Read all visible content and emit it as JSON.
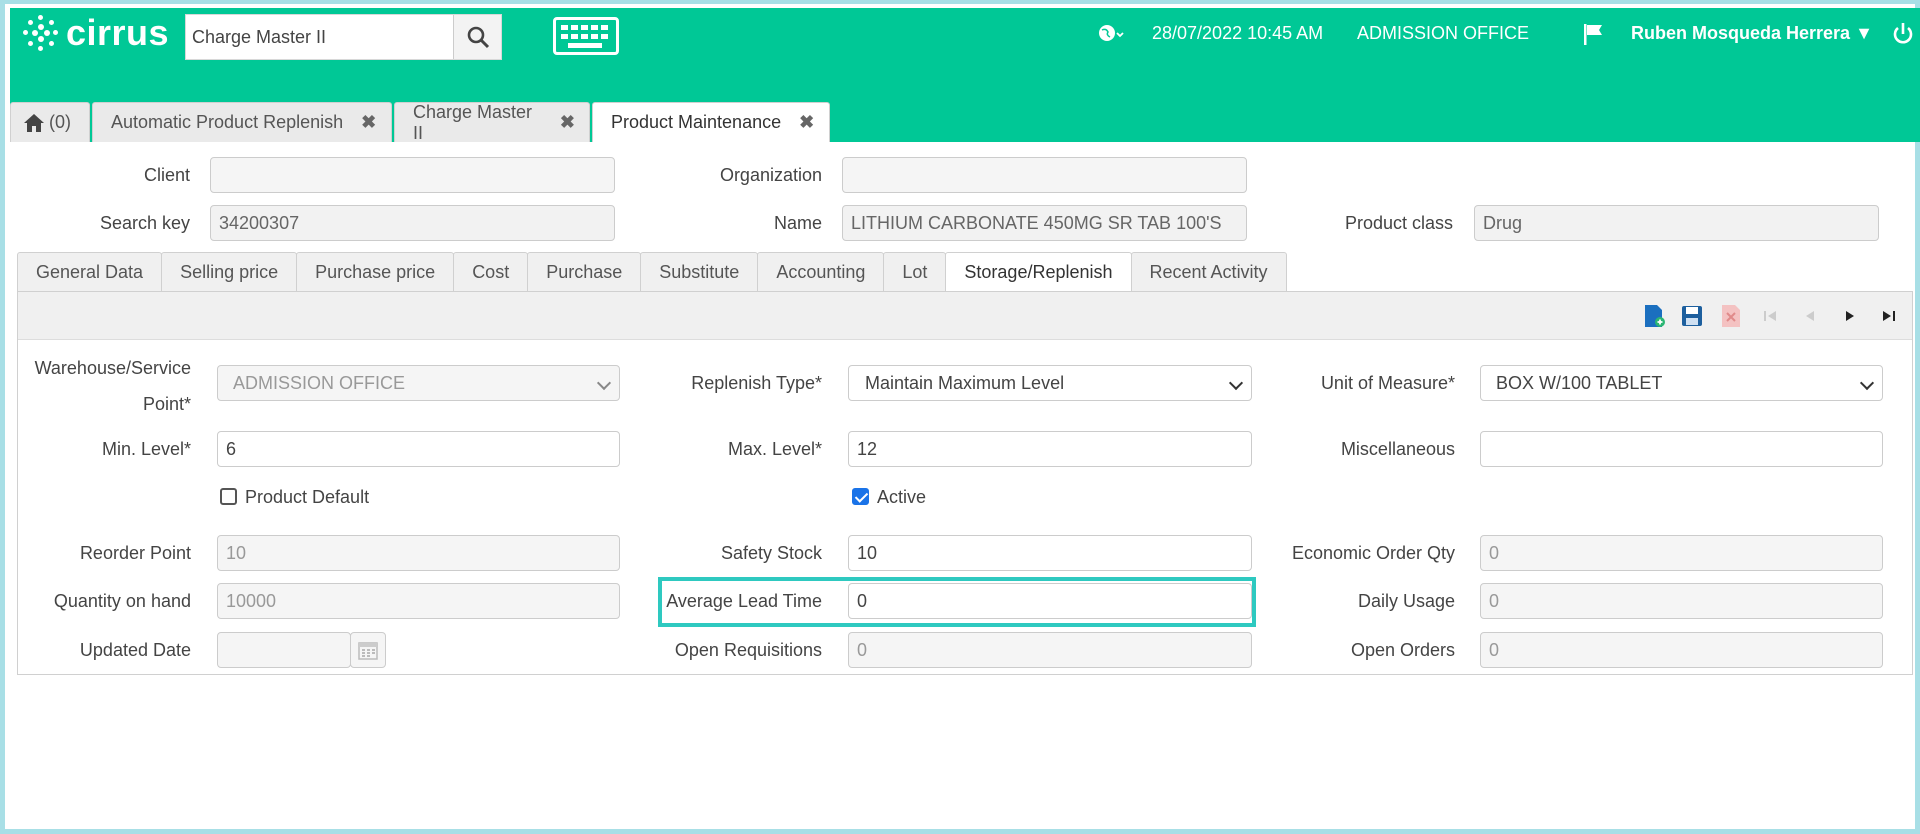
{
  "header": {
    "logo_text": "cirrus",
    "search_value": "Charge Master II",
    "datetime": "28/07/2022 10:45 AM",
    "location": "ADMISSION OFFICE",
    "user": "Ruben Mosqueda Herrera",
    "brand_color": "#00c896"
  },
  "window_tabs": [
    {
      "label": "(0)",
      "icon": "home-icon"
    },
    {
      "label": "Automatic Product Replenish"
    },
    {
      "label": "Charge Master II"
    },
    {
      "label": "Product Maintenance"
    }
  ],
  "header_form": {
    "client_label": "Client",
    "client_value": "",
    "org_label": "Organization",
    "org_value": "",
    "search_key_label": "Search key",
    "search_key_value": "34200307",
    "name_label": "Name",
    "name_value": "LITHIUM CARBONATE 450MG SR TAB 100'S",
    "product_class_label": "Product class",
    "product_class_value": "Drug"
  },
  "subtabs": [
    "General Data",
    "Selling price",
    "Purchase price",
    "Cost",
    "Purchase",
    "Substitute",
    "Accounting",
    "Lot",
    "Storage/Replenish",
    "Recent Activity"
  ],
  "detail": {
    "warehouse_label_1": "Warehouse/Service",
    "warehouse_label_2": "Point*",
    "warehouse_value": "ADMISSION OFFICE",
    "replenish_type_label": "Replenish Type*",
    "replenish_type_value": "Maintain Maximum Level",
    "uom_label": "Unit of Measure*",
    "uom_value": "BOX W/100 TABLET",
    "min_level_label": "Min. Level*",
    "min_level_value": "6",
    "max_level_label": "Max. Level*",
    "max_level_value": "12",
    "misc_label": "Miscellaneous",
    "misc_value": "",
    "product_default_label": "Product Default",
    "product_default_checked": false,
    "active_label": "Active",
    "active_checked": true,
    "reorder_point_label": "Reorder Point",
    "reorder_point_value": "10",
    "safety_stock_label": "Safety Stock",
    "safety_stock_value": "10",
    "eoq_label": "Economic Order Qty",
    "eoq_value": "0",
    "qty_on_hand_label": "Quantity on hand",
    "qty_on_hand_value": "10000",
    "avg_lead_time_label": "Average Lead Time",
    "avg_lead_time_value": "0",
    "daily_usage_label": "Daily Usage",
    "daily_usage_value": "0",
    "updated_date_label": "Updated Date",
    "updated_date_value": "",
    "open_req_label": "Open Requisitions",
    "open_req_value": "0",
    "open_orders_label": "Open Orders",
    "open_orders_value": "0"
  }
}
